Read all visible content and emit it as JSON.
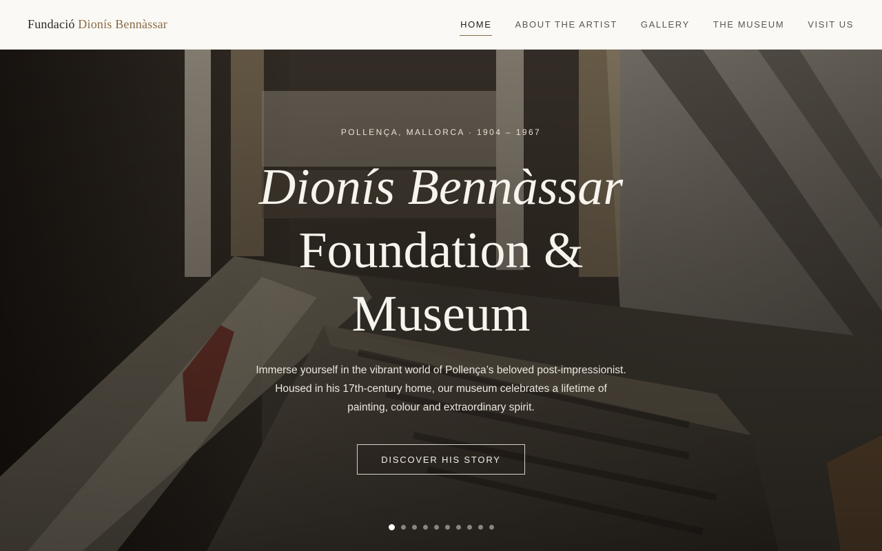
{
  "header": {
    "logo_first": "Fundació",
    "logo_second": "Dionís Bennàssar",
    "nav": [
      {
        "label": "HOME",
        "active": true
      },
      {
        "label": "ABOUT THE ARTIST",
        "active": false
      },
      {
        "label": "GALLERY",
        "active": false
      },
      {
        "label": "THE MUSEUM",
        "active": false
      },
      {
        "label": "VISIT US",
        "active": false
      }
    ]
  },
  "hero": {
    "eyebrow": "POLLENÇA, MALLORCA · 1904 – 1967",
    "title_line1": "Dionís Bennàssar",
    "title_line2": "Foundation &",
    "title_line3": "Museum",
    "subtitle": "Immerse yourself in the vibrant world of Pollença’s beloved post-impressionist. Housed in his 17th-century home, our museum celebrates a lifetime of painting, colour and extraordinary spirit.",
    "cta_label": "DISCOVER HIS STORY",
    "slides_total": 10,
    "slide_active": 1
  },
  "colors": {
    "header_bg": "#faf9f6",
    "accent": "#8a6a44",
    "hero_text": "#f4f1ea"
  }
}
